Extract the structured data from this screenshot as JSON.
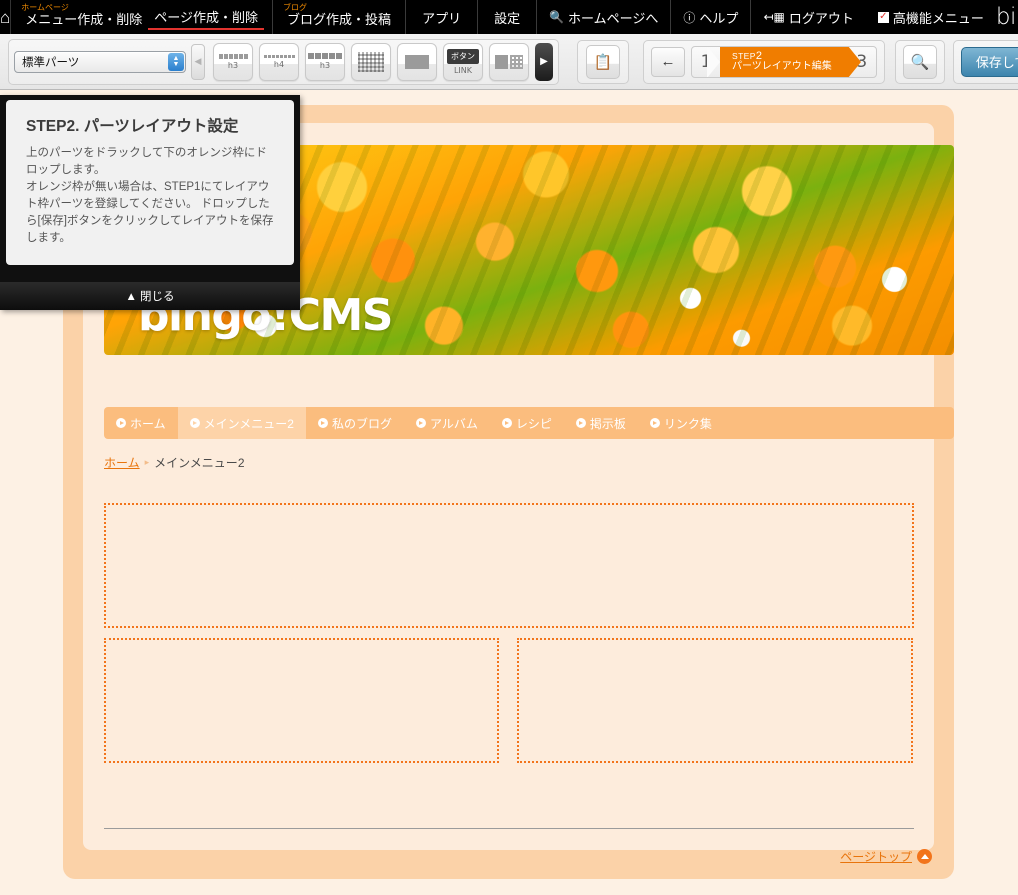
{
  "topbar": {
    "home_icon": "home-icon",
    "groups": [
      {
        "label": "ホームページ",
        "items": [
          {
            "text": "メニュー作成・削除",
            "active": false
          },
          {
            "text": "ページ作成・削除",
            "active": true
          }
        ]
      },
      {
        "label": "ブログ",
        "items": [
          {
            "text": "ブログ作成・投稿",
            "active": false
          }
        ]
      }
    ],
    "app": "アプリ",
    "settings": "設定",
    "goto_homepage": "ホームページへ",
    "help": "ヘルプ",
    "logout": "ログアウト",
    "advanced_menu": "高機能メニュー",
    "brand": "bingo!CMS"
  },
  "toolbar": {
    "parts_select_value": "標準パーツ",
    "parts": [
      {
        "name": "heading-h3-part",
        "label": "h3",
        "icon": "bars"
      },
      {
        "name": "heading-h4-part",
        "label": "h4",
        "icon": "bars-thin"
      },
      {
        "name": "heading-h3-box-part",
        "label": "h3",
        "icon": "bars-wide"
      },
      {
        "name": "text-block-part",
        "label": "",
        "icon": "grid"
      },
      {
        "name": "image-part",
        "label": "",
        "icon": "block"
      },
      {
        "name": "button-link-part",
        "label": "LINK",
        "icon": "button-tag",
        "tag": "ボタン"
      },
      {
        "name": "image-text-part",
        "label": "",
        "icon": "mix"
      }
    ],
    "prev_arrow": "◀",
    "next_arrow": "▶",
    "clipboard_icon": "clipboard-icon",
    "back_icon": "←",
    "step_prev_num": "1",
    "step_next_num": "3",
    "step_word": "STEP",
    "step_current_num": "2",
    "step_current_label": "パーツレイアウト編集",
    "search_icon": "search-icon",
    "save_label": "保存して次へ"
  },
  "help": {
    "title": "STEP2. パーツレイアウト設定",
    "body_line1": "上のパーツをドラックして下のオレンジ枠にドロップします。",
    "body_line2": "オレンジ枠が無い場合は、STEP1にてレイアウト枠パーツを登録してください。 ドロップしたら[保存]ボタンをクリックしてレイアウトを保存します。",
    "close_label": "▲ 閉じる"
  },
  "page": {
    "hero_title": "bingo!CMS",
    "nav": [
      {
        "label": "ホーム",
        "current": false
      },
      {
        "label": "メインメニュー2",
        "current": true
      },
      {
        "label": "私のブログ",
        "current": false
      },
      {
        "label": "アルバム",
        "current": false
      },
      {
        "label": "レシピ",
        "current": false
      },
      {
        "label": "掲示板",
        "current": false
      },
      {
        "label": "リンク集",
        "current": false
      }
    ],
    "breadcrumb_home": "ホーム",
    "breadcrumb_sep": "▸",
    "breadcrumb_current": "メインメニュー2",
    "pagetop_label": "ページトップ"
  },
  "colors": {
    "accent_orange": "#f07d00",
    "frame_dotted": "#f2741b",
    "nav_bg": "#fbbd7e",
    "nav_active": "#fdd3a8",
    "page_bg": "#fdecdc",
    "page_outer": "#fbd2a8",
    "canvas_bg": "#fdf1e4",
    "save_button": "#3c84ad",
    "menu_active_underline": "#e3342f"
  }
}
